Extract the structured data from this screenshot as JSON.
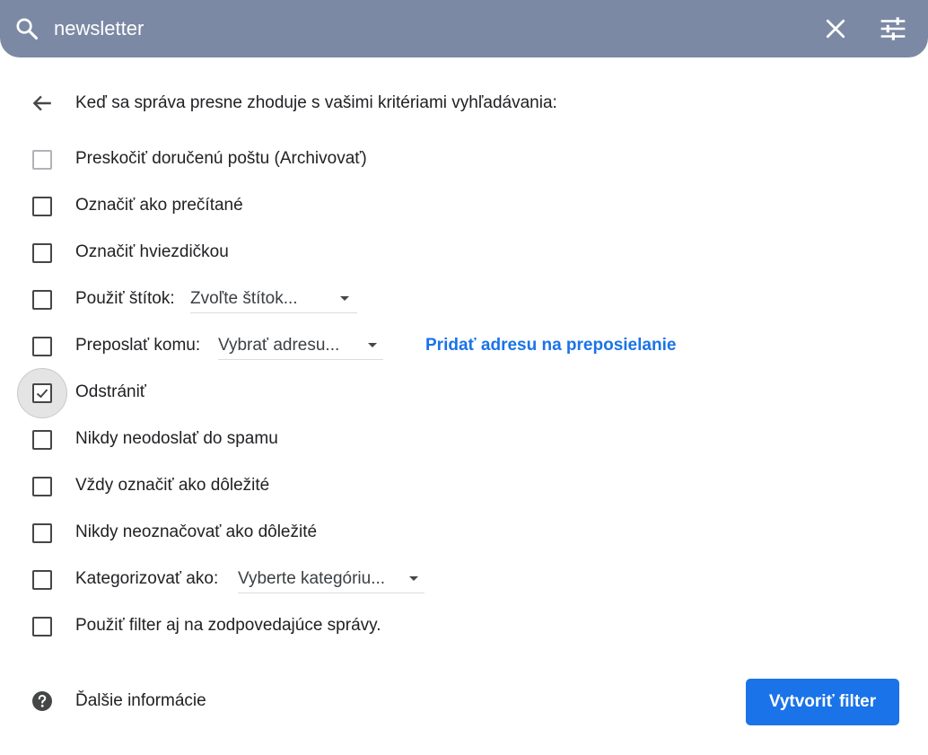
{
  "search": {
    "query": "newsletter"
  },
  "filter_panel": {
    "heading": "Keď sa správa presne zhoduje s vašimi kritériami vyhľadávania:",
    "options": [
      {
        "label": "Preskočiť doručenú poštu (Archivovať)",
        "checked": false
      },
      {
        "label": "Označiť ako prečítané",
        "checked": false
      },
      {
        "label": "Označiť hviezdičkou",
        "checked": false
      },
      {
        "label": "Použiť štítok:",
        "checked": false,
        "select_value": "Zvoľte štítok..."
      },
      {
        "label": "Preposlať komu:",
        "checked": false,
        "select_value": "Vybrať adresu...",
        "link": "Pridať adresu na preposielanie"
      },
      {
        "label": "Odstrániť",
        "checked": true
      },
      {
        "label": "Nikdy neodoslať do spamu",
        "checked": false
      },
      {
        "label": "Vždy označiť ako dôležité",
        "checked": false
      },
      {
        "label": "Nikdy neoznačovať ako dôležité",
        "checked": false
      },
      {
        "label": "Kategorizovať ako:",
        "checked": false,
        "select_value": "Vyberte kategóriu..."
      },
      {
        "label": "Použiť filter aj na zodpovedajúce správy.",
        "checked": false
      }
    ],
    "help_text": "Ďalšie informácie",
    "create_button": "Vytvoriť filter"
  },
  "colors": {
    "search_bar": "#7c89a4",
    "primary": "#1a73e8",
    "text": "#202124"
  }
}
